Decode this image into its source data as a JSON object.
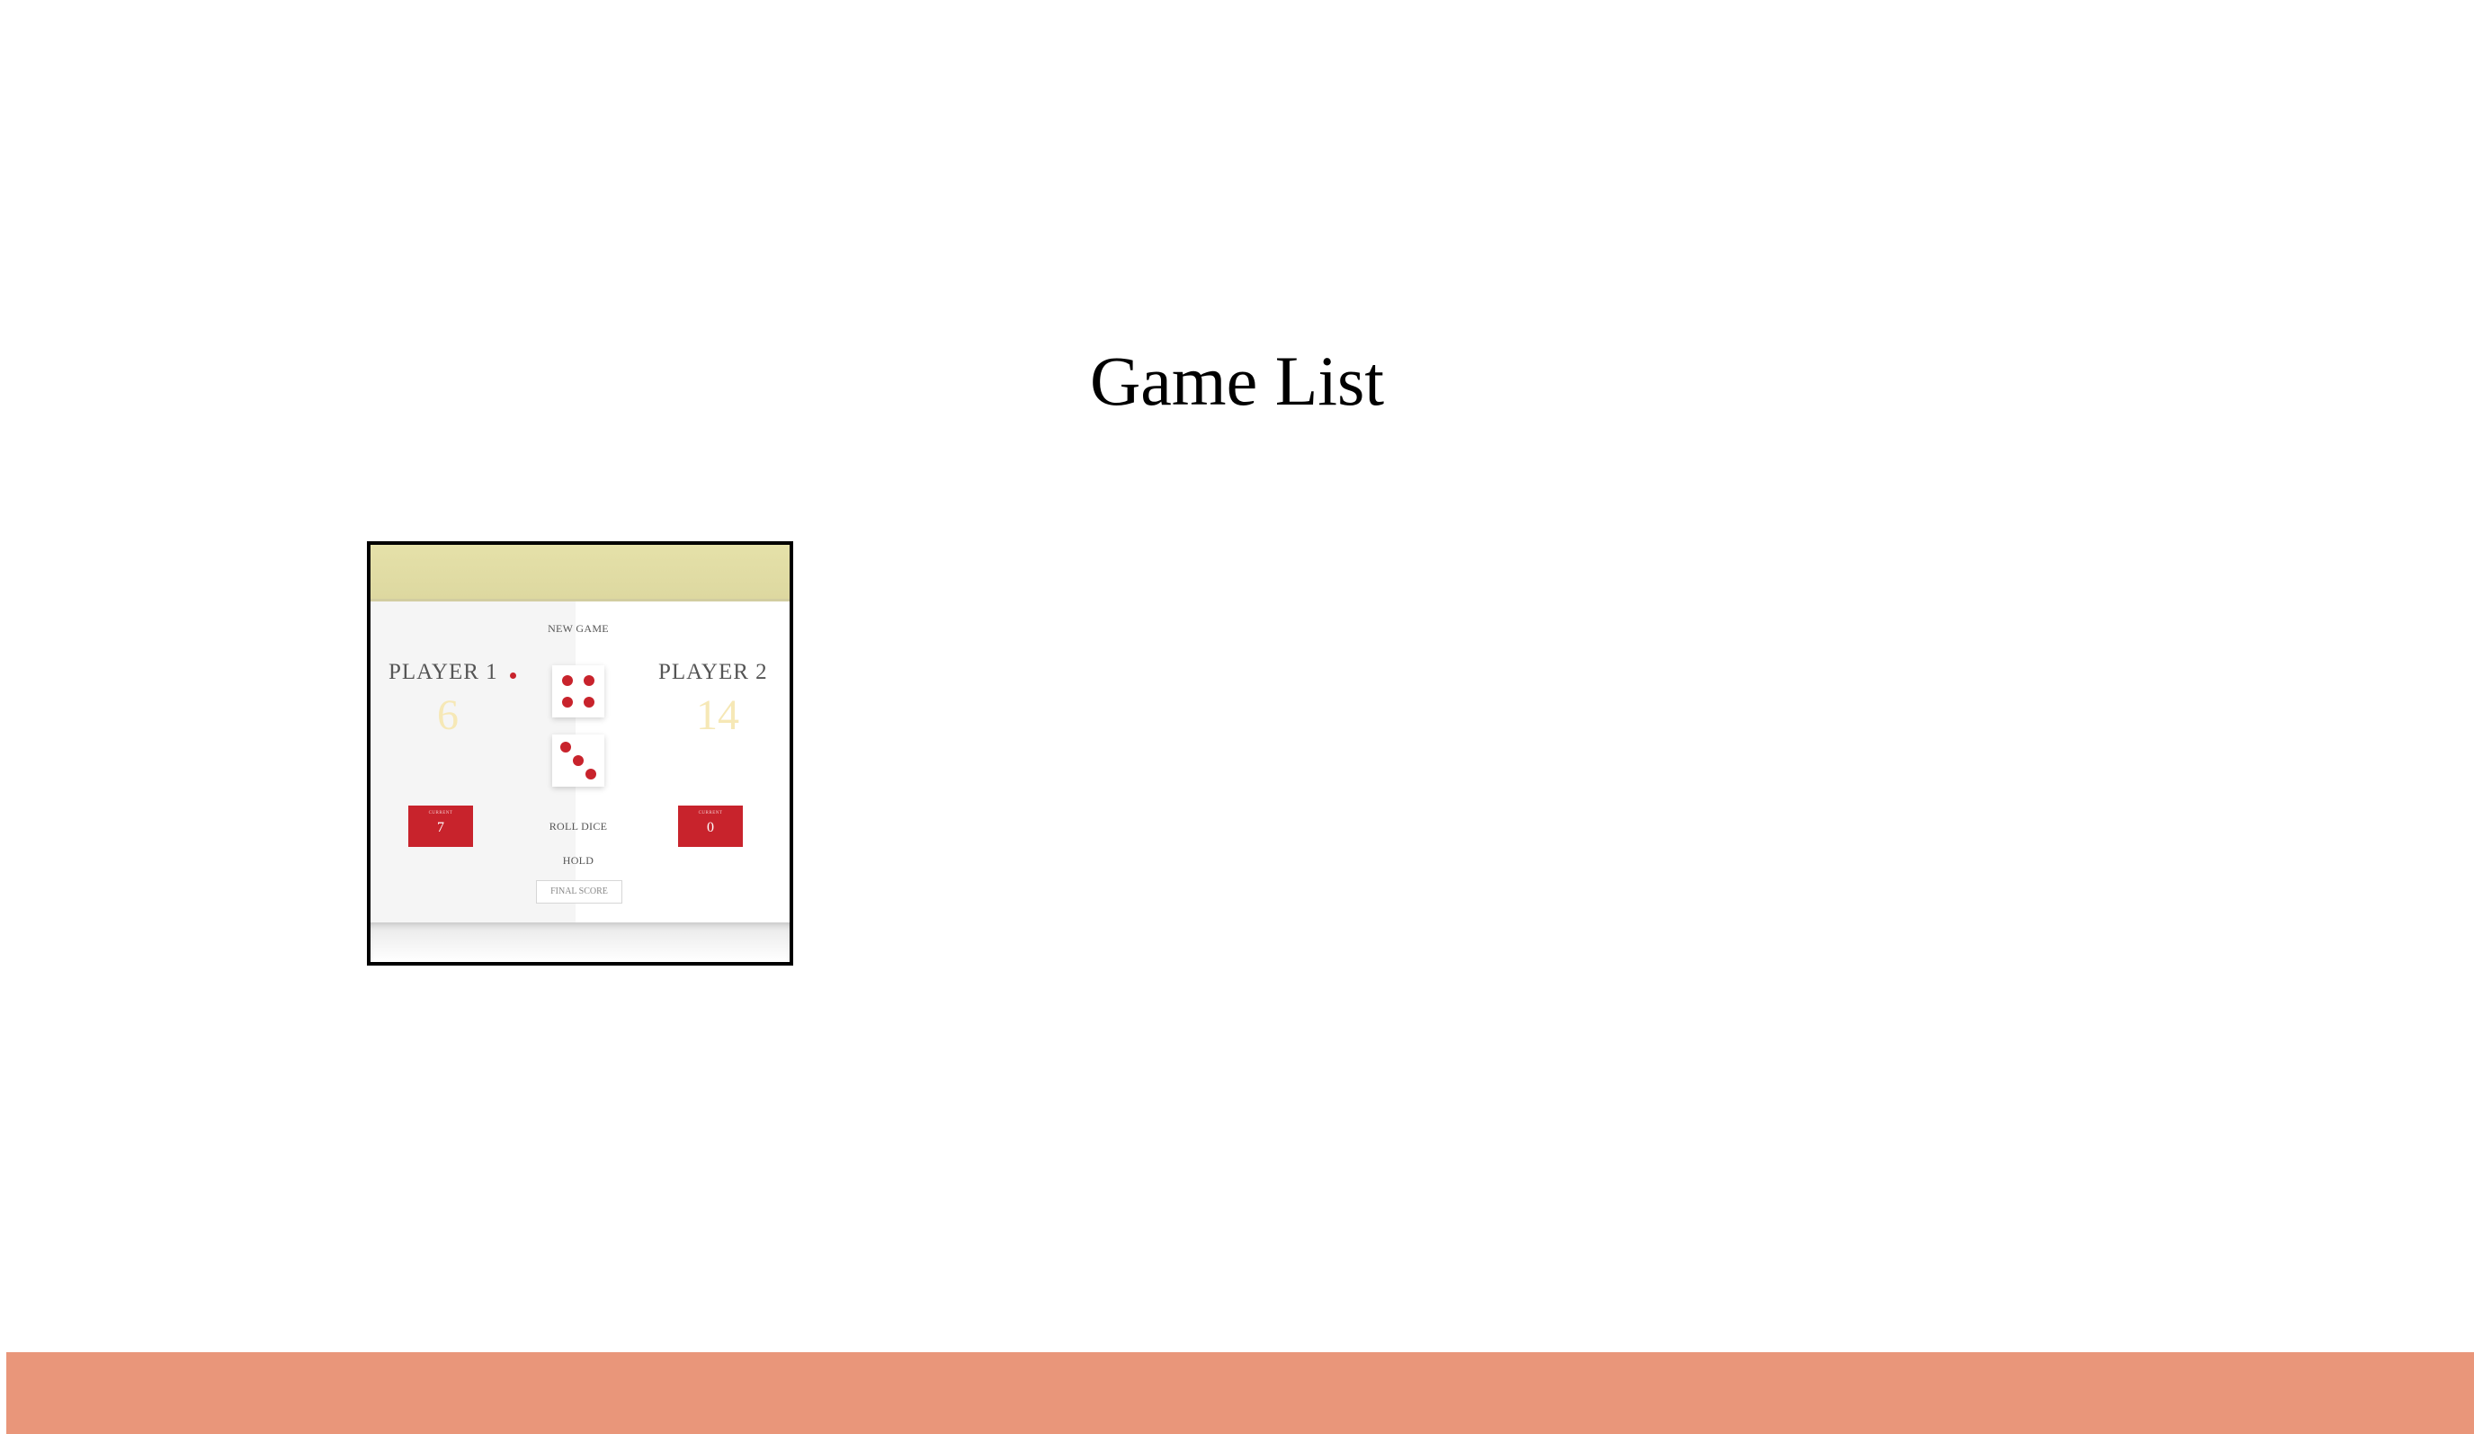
{
  "page": {
    "title": "Game List",
    "footer_color": "#e9967a"
  },
  "games": [
    {
      "preview": {
        "player1": {
          "name": "PLAYER 1",
          "score": "6",
          "current_label": "CURRENT",
          "current": "7",
          "active": true
        },
        "player2": {
          "name": "PLAYER 2",
          "score": "14",
          "current_label": "CURRENT",
          "current": "0",
          "active": false
        },
        "buttons": {
          "new_game": "NEW GAME",
          "roll_dice": "ROLL DICE",
          "hold": "HOLD",
          "final_score_placeholder": "FINAL SCORE"
        },
        "dice": [
          4,
          3
        ],
        "accent_color": "#c8232c",
        "score_color": "#f6e8b6",
        "topbar_color": "#e5e1a9"
      }
    }
  ]
}
